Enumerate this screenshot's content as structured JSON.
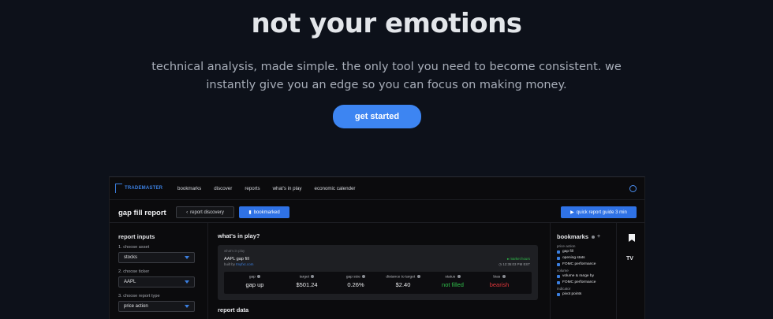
{
  "hero": {
    "title": "not your emotions",
    "subtitle": "technical analysis, made simple. the only tool you need to become consistent. we instantly give you an edge so you can focus on making money.",
    "cta_label": "get started"
  },
  "app": {
    "brand": "TRADEMASTER",
    "nav": [
      "bookmarks",
      "discover",
      "reports",
      "what's in play",
      "economic calender"
    ],
    "page_title": "gap fill report",
    "discovery_label": "report discovery",
    "bookmarked_label": "bookmarked",
    "guide_label": "quick report guide 3 min",
    "inputs": {
      "heading": "report inputs",
      "asset_label": "1. choose asset",
      "asset_value": "stocks",
      "ticker_label": "2. choose ticker",
      "ticker_value": "AAPL",
      "type_label": "3. choose report type",
      "type_value": "price action"
    },
    "play": {
      "heading": "what's in play?",
      "card_tag": "what's in play",
      "report_name": "AAPL gap fill",
      "built_by_prefix": "built by",
      "built_by": "tmyfxc.com",
      "market_status": "market hours",
      "timestamp": "12:35:03 PM EST",
      "stats": [
        {
          "label": "gap",
          "value": "gap up",
          "color": "#e9eaec"
        },
        {
          "label": "target",
          "value": "$501.24",
          "color": "#e9eaec"
        },
        {
          "label": "gap size",
          "value": "0.26%",
          "color": "#e9eaec"
        },
        {
          "label": "distance to target",
          "value": "$2.40",
          "color": "#e9eaec"
        },
        {
          "label": "status",
          "value": "not filled",
          "color": "#2fbf4a"
        },
        {
          "label": "bias",
          "value": "bearish",
          "color": "#e0363a"
        }
      ],
      "report_data_heading": "report data"
    },
    "bookmarks": {
      "heading": "bookmarks",
      "sections": [
        {
          "name": "price action",
          "items": [
            "gap fill",
            "opening stats",
            "FOMC performance"
          ]
        },
        {
          "name": "volume",
          "items": [
            "volume & range by",
            "FOMC performance"
          ]
        },
        {
          "name": "indicator",
          "items": [
            "pivot points"
          ]
        }
      ]
    },
    "rail": {
      "tv_label": "TV"
    }
  },
  "colors": {
    "accent": "#3d85f2",
    "green": "#2fbf4a",
    "red": "#e0363a",
    "bg": "#0d111a"
  }
}
